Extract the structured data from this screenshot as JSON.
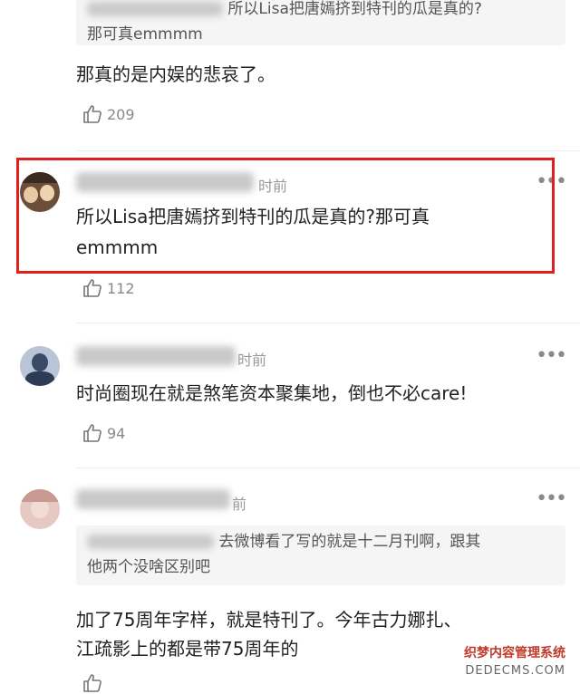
{
  "comments": [
    {
      "quote_line1": "所以Lisa把唐嫣挤到特刊的瓜是真的?",
      "quote_line2": "那可真emmmm",
      "text": "那真的是内娱的悲哀了。",
      "likes": "209"
    },
    {
      "time": "时前",
      "text_line1": "所以Lisa把唐嫣挤到特刊的瓜是真的?那可真",
      "text_line2": "emmmm",
      "likes": "112",
      "highlight_color": "#e02020"
    },
    {
      "time": "时前",
      "text": "时尚圈现在就是煞笔资本聚集地，倒也不必care!",
      "likes": "94"
    },
    {
      "time": "前",
      "quote_line1": "去微博看了写的就是十二月刊啊，跟其",
      "quote_line2": "他两个没啥区别吧",
      "text_line1": "加了75周年字样，就是特刊了。今年古力娜扎、",
      "text_line2": "江疏影上的都是带75周年的"
    }
  ],
  "more_icon": "more-icon",
  "like_icon": "thumbs-up-icon",
  "watermark": {
    "line1": "织梦内容管理系统",
    "line2": "DEDECMS.COM"
  }
}
